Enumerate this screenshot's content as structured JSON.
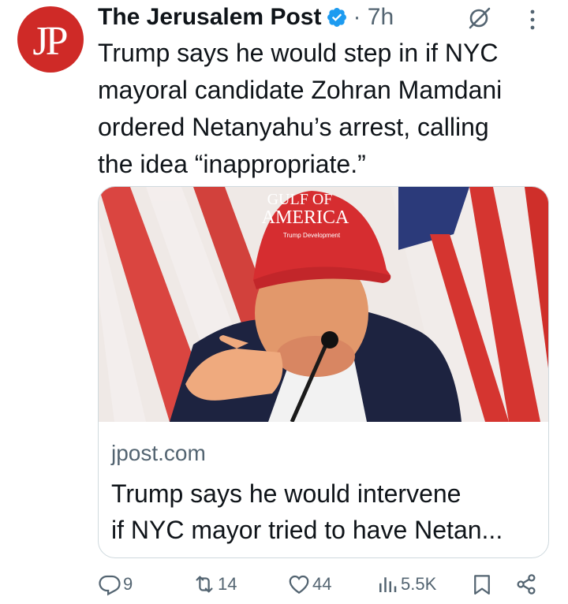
{
  "author": {
    "avatar_letters": "JP",
    "name": "The Jerusalem Post",
    "time": "· 7h"
  },
  "tweet": {
    "text": "Trump says he would step in if NYC\nmayoral candidate Zohran Mamdani\nordered Netanyahu’s arrest, calling\nthe idea “inappropriate.”"
  },
  "card": {
    "image_hat_line1": "GULF OF",
    "image_hat_line2": "AMERICA",
    "image_hat_small": "Trump Development",
    "domain": "jpost.com",
    "title": "Trump says he would intervene\nif NYC mayor tried to have Netan..."
  },
  "actions": {
    "replies": "9",
    "reposts": "14",
    "likes": "44",
    "views": "5.5K"
  },
  "colors": {
    "brand": "#cf2a27",
    "verified": "#1d9bf0",
    "muted": "#536471"
  },
  "icons": [
    "verified-badge-icon",
    "grok-icon",
    "more-icon",
    "reply-icon",
    "repost-icon",
    "like-icon",
    "views-icon",
    "bookmark-icon",
    "share-icon"
  ]
}
